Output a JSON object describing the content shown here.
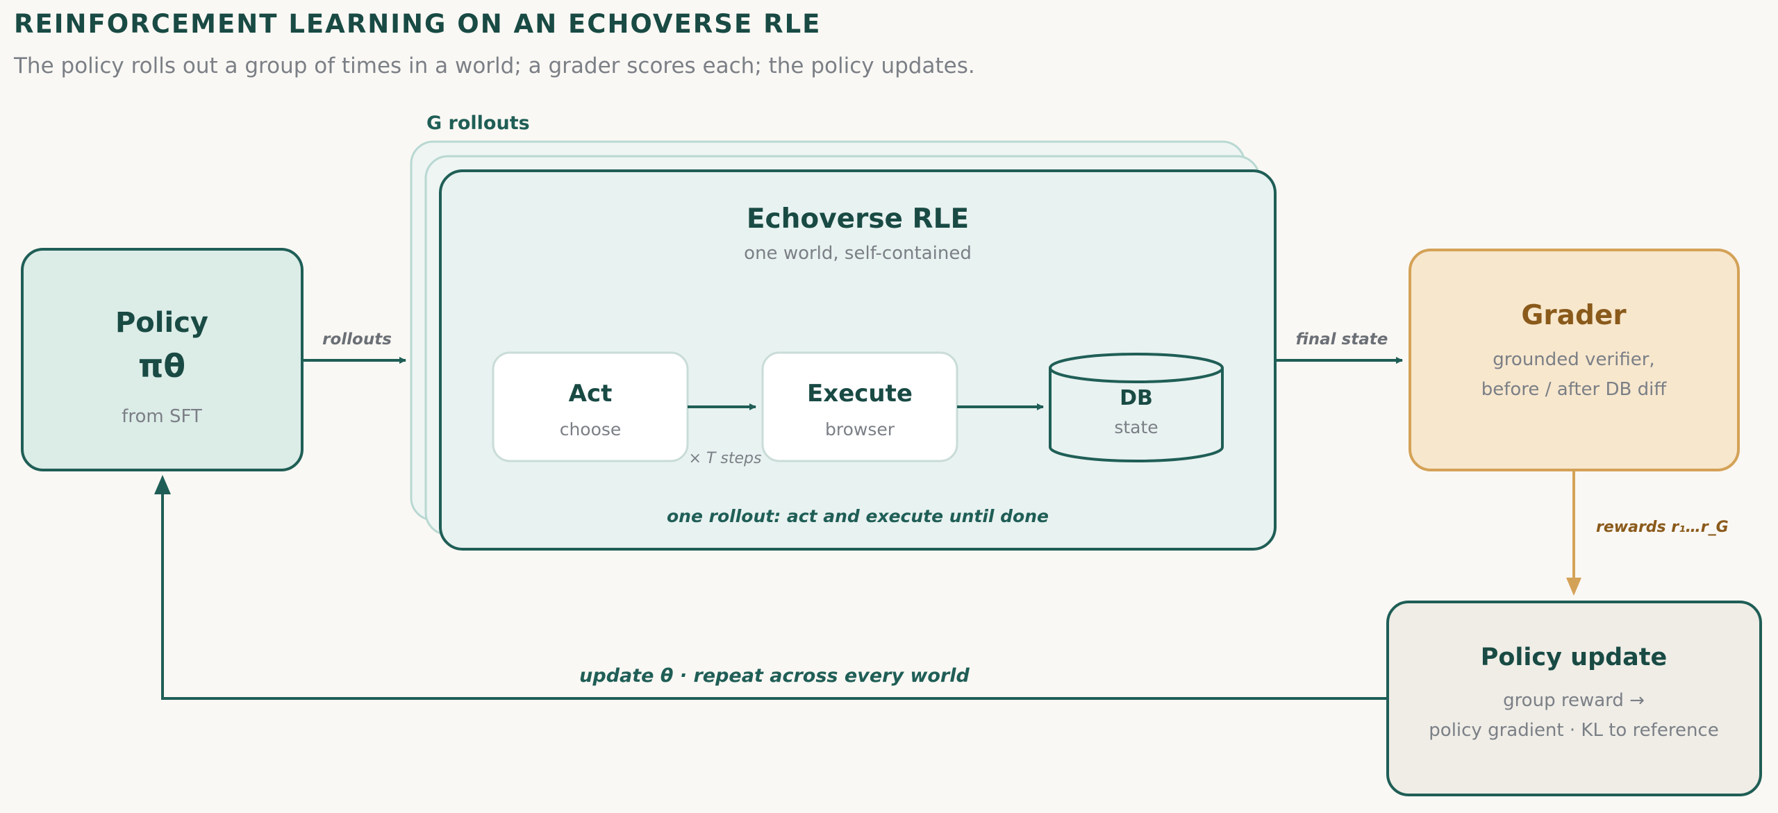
{
  "header": {
    "title": "REINFORCEMENT LEARNING ON AN ECHOVERSE RLE",
    "subtitle": "The policy rolls out a group of times in a world; a grader scores each; the policy updates."
  },
  "policy": {
    "title": "Policy",
    "symbol": "πθ",
    "subtitle": "from SFT"
  },
  "edges": {
    "rollouts": "rollouts",
    "final_state": "final state",
    "rewards": "rewards r₁…r_G",
    "update": "update θ · repeat across every world",
    "t_steps": "× T steps"
  },
  "rle": {
    "stack_label": "G rollouts",
    "title": "Echoverse RLE",
    "subtitle": "one world, self-contained",
    "footer": "one rollout: act and execute until done",
    "act": {
      "title": "Act",
      "subtitle": "choose"
    },
    "execute": {
      "title": "Execute",
      "subtitle": "browser"
    },
    "db": {
      "title": "DB",
      "subtitle": "state"
    }
  },
  "grader": {
    "title": "Grader",
    "line1": "grounded verifier,",
    "line2": "before / after DB diff"
  },
  "update_box": {
    "title": "Policy update",
    "line1": "group reward →",
    "line2": "policy gradient · KL to reference"
  },
  "colors": {
    "teal": "#1f5e56",
    "teal_dark": "#194a44",
    "policy_fill": "#dcece7",
    "rle_fill": "#e8f2f0",
    "stack_stroke": "#b9d8d2",
    "grader_fill": "#f7e7cd",
    "grader_stroke": "#d4a257",
    "grader_text": "#8a5a1b",
    "update_fill": "#efede6",
    "muted": "#7b7f86"
  }
}
